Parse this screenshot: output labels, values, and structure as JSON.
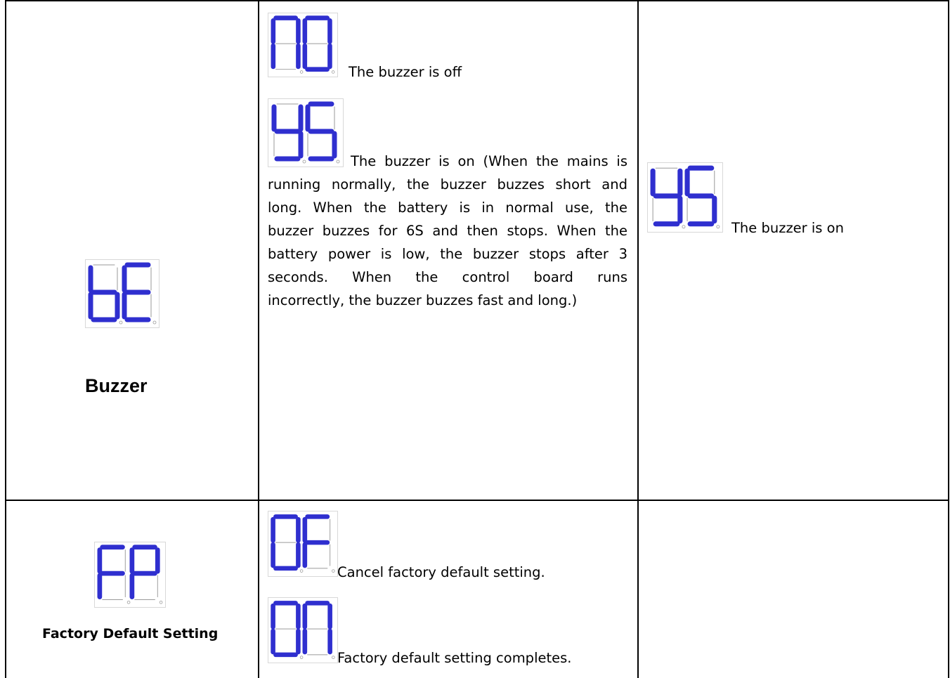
{
  "rows": [
    {
      "setting": {
        "display": "bE",
        "label": "Buzzer"
      },
      "options": [
        {
          "display": "no",
          "text": "The buzzer is off"
        },
        {
          "display": "yS",
          "text_lines": [
            "The buzzer is on (When the mains is",
            "running normally, the buzzer buzzes short and",
            "long. When the battery is in normal use, the",
            "buzzer buzzes for 6S and then stops. When the",
            "battery power is low, the buzzer stops after 3",
            "seconds. When the control board runs",
            "incorrectly, the buzzer buzzes fast and long.)"
          ]
        }
      ],
      "default": {
        "display": "yS",
        "text": "The buzzer is on"
      }
    },
    {
      "setting": {
        "display": "FP",
        "label": "Factory Default Setting"
      },
      "options": [
        {
          "display": "oF",
          "text": "Cancel factory default setting."
        },
        {
          "display": "on",
          "text": "Factory default setting completes."
        }
      ],
      "default": {}
    }
  ],
  "colors": {
    "segment_on": "#2f2fcf",
    "segment_off": "#9a9a9a",
    "border": "#000000"
  }
}
